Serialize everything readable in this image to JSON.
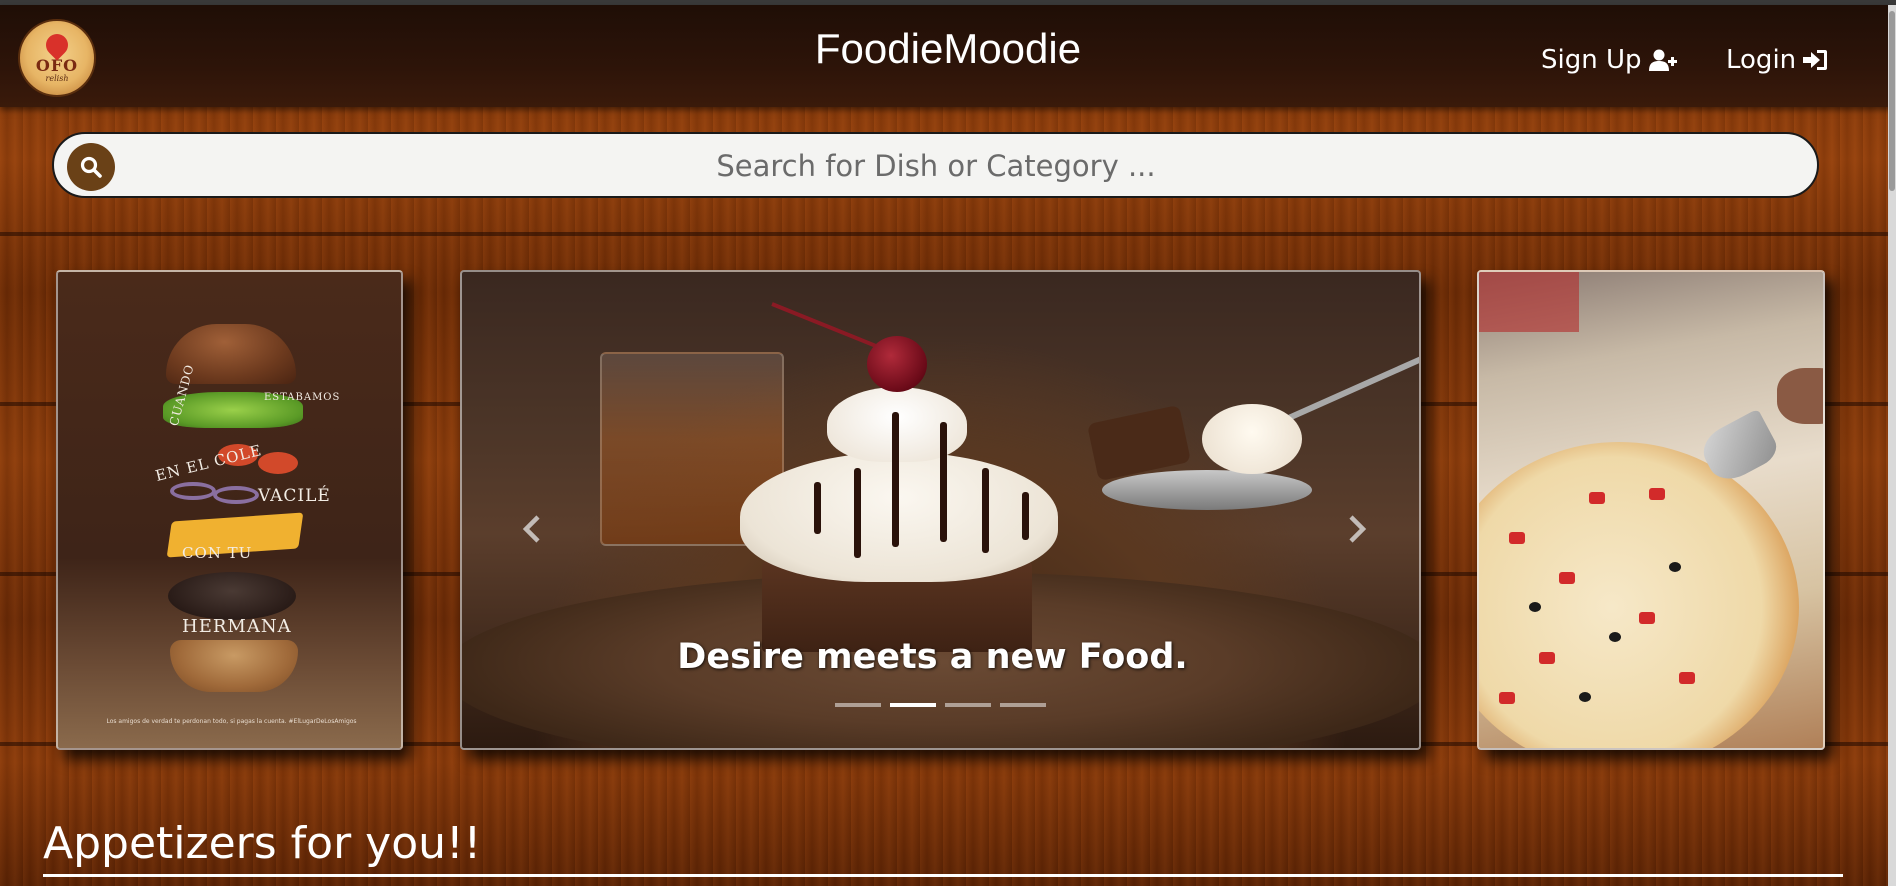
{
  "navbar": {
    "brand": "FoodieMoodie",
    "logo": {
      "text": "OFO",
      "subtext": "relish"
    },
    "signup_label": "Sign Up",
    "signup_icon": "user-plus-icon",
    "login_label": "Login",
    "login_icon": "sign-in-icon"
  },
  "search": {
    "placeholder": "Search for Dish or Category ...",
    "value": "",
    "icon": "search-icon"
  },
  "poster": {
    "words": [
      "CUANDO",
      "ESTABAMOS",
      "EN EL COLE",
      "VACILÉ",
      "CON TU",
      "HERMANA"
    ],
    "fine_print": "Los amigos de verdad te perdonan todo, si pagas la cuenta. #ElLugarDeLosAmigos"
  },
  "carousel": {
    "caption": "Desire meets a new Food.",
    "active_slide": 2,
    "slide_count": 4,
    "prev_icon": "chevron-left-icon",
    "next_icon": "chevron-right-icon"
  },
  "section": {
    "title": "Appetizers for you!!"
  },
  "colors": {
    "navbar": "#2d1409",
    "search_button": "#6a4117",
    "wood": "#7a3208"
  }
}
